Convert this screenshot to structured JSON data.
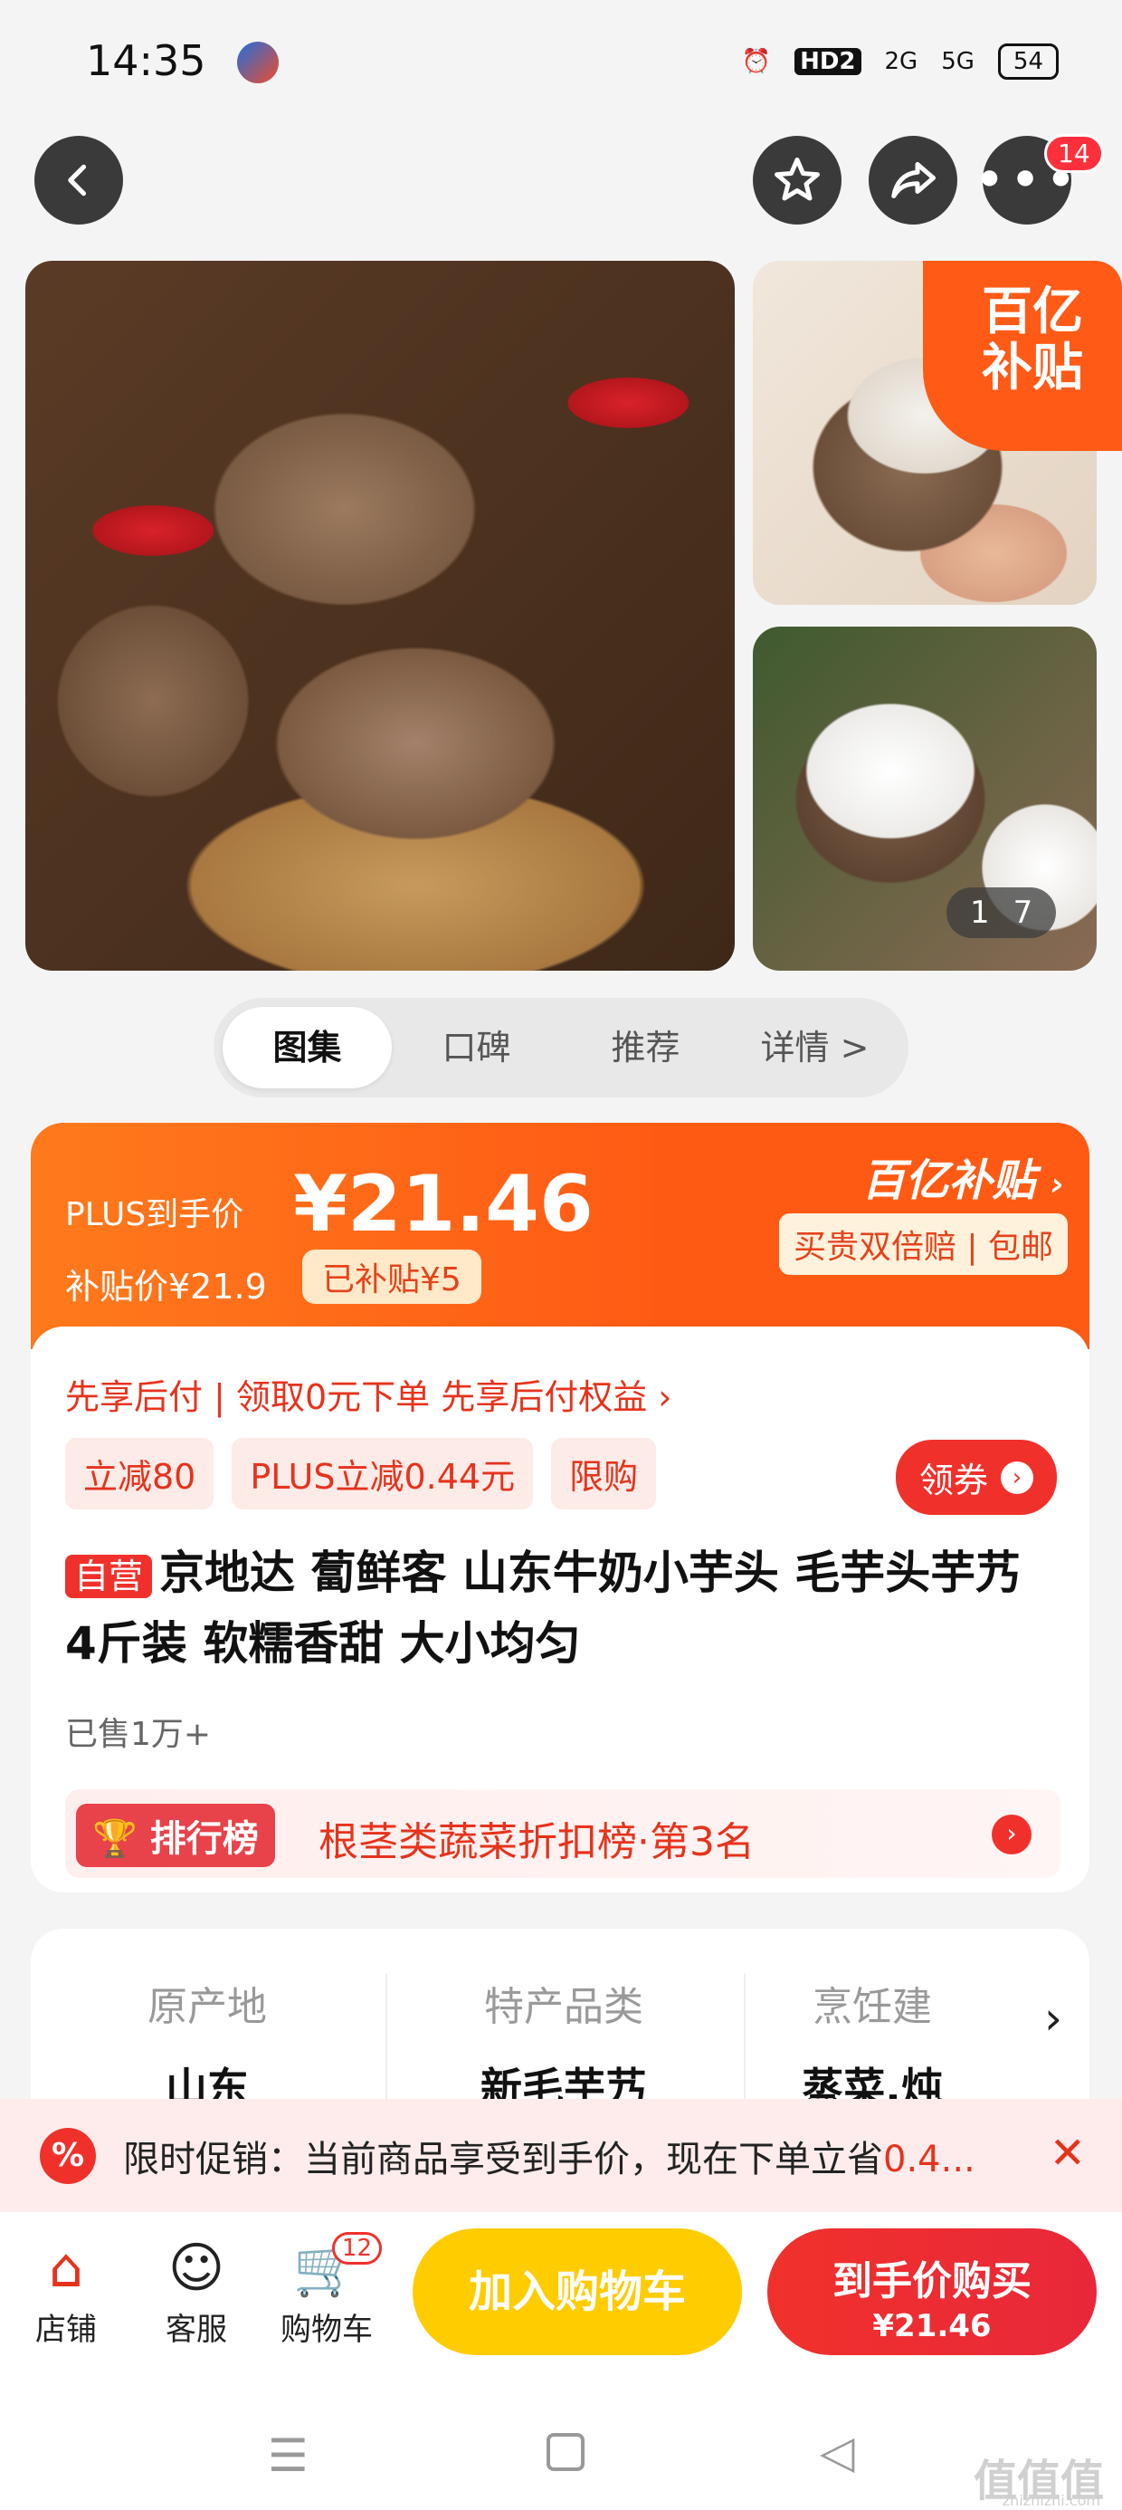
{
  "status_bar": {
    "time": "14:35",
    "network_hd": "HD2",
    "signal_1": "2G",
    "signal_2": "5G",
    "battery": "54"
  },
  "top_nav": {
    "more_badge": "14"
  },
  "gallery": {
    "subsidy_tag_line1": "百亿",
    "subsidy_tag_line2": "补贴",
    "counter_current": "1",
    "counter_total": "7"
  },
  "tabs": [
    {
      "label": "图集",
      "active": true
    },
    {
      "label": "口碑"
    },
    {
      "label": "推荐"
    },
    {
      "label": "详情 >"
    }
  ],
  "price": {
    "plus_label": "PLUS到手价",
    "plus_price": "¥21.46",
    "subsidy_price": "补贴价¥21.9",
    "subsidy_pill": "已补贴¥5",
    "brand": "百亿补贴",
    "brand_sub": "买贵双倍赔 | 包邮"
  },
  "pay_later": "先享后付 | 领取0元下单 先享后付权益 ›",
  "chips": [
    "立减80",
    "PLUS立减0.44元",
    "限购"
  ],
  "coupon_label": "领券",
  "product": {
    "self_tag": "自营",
    "title": "京地达 蔔鲜客 山东牛奶小芋头 毛芋头芋艿 4斤装 软糯香甜 大小均匀",
    "sold": "已售1万+"
  },
  "rank": {
    "pill": "排行榜",
    "text": "根茎类蔬菜折扣榜·第3名"
  },
  "attributes": [
    {
      "label": "原产地",
      "value": "山东"
    },
    {
      "label": "特产品类",
      "value": "新毛芋艿"
    },
    {
      "label": "烹饪建",
      "value": "蒸菜,炖"
    }
  ],
  "promo": {
    "icon": "%",
    "text_prefix": "限时促销：当前商品享受到手价，现在下单立省",
    "text_highlight": "0.4..."
  },
  "bottom_bar": {
    "shop": "店铺",
    "service": "客服",
    "cart": "购物车",
    "cart_badge": "12",
    "add_cart": "加入购物车",
    "buy_label": "到手价购买",
    "buy_price": "¥21.46"
  },
  "watermark": {
    "main": "值值值",
    "sub": "zhizhizhi.com"
  },
  "colors": {
    "accent_red": "#f0312b",
    "accent_orange": "#ff5a14",
    "add_cart_yellow": "#ffcc00"
  }
}
